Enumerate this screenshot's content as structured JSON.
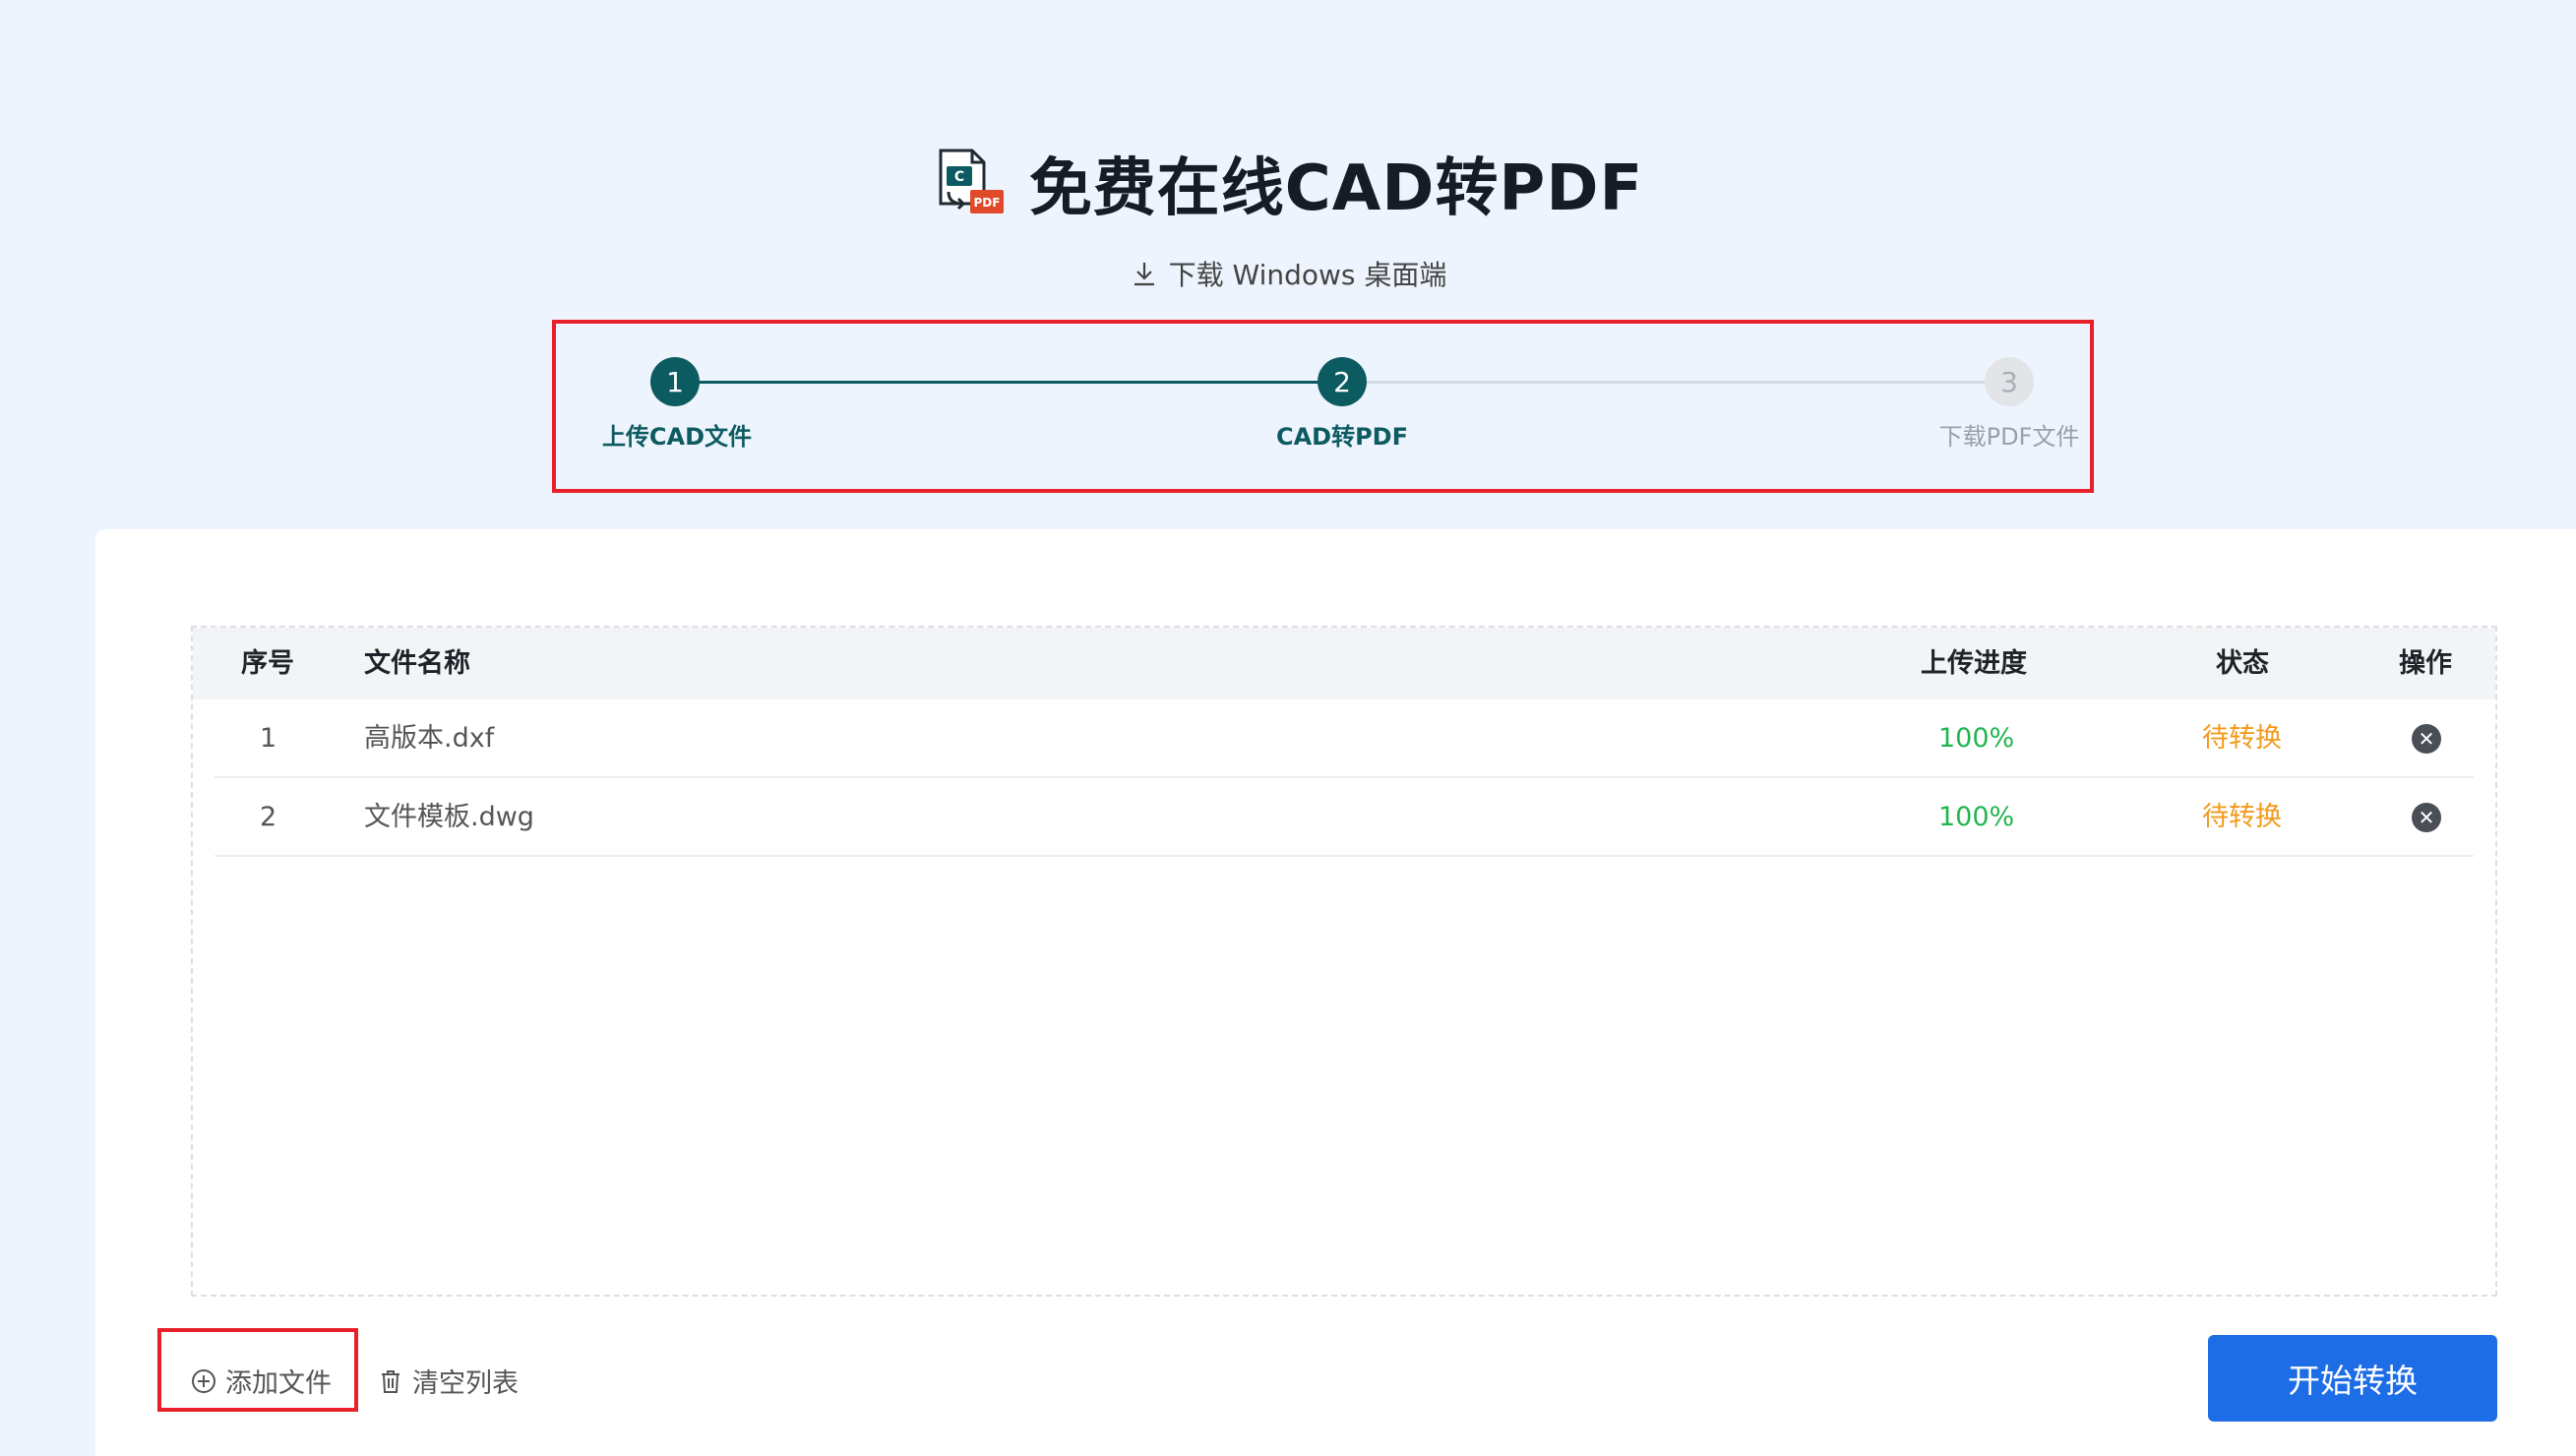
{
  "header": {
    "title": "免费在线CAD转PDF",
    "download_label": "下载 Windows 桌面端",
    "logo_badge_letter": "C",
    "logo_badge_pdf": "PDF"
  },
  "steps": [
    {
      "number": "1",
      "label": "上传CAD文件",
      "state": "done"
    },
    {
      "number": "2",
      "label": "CAD转PDF",
      "state": "active"
    },
    {
      "number": "3",
      "label": "下载PDF文件",
      "state": "pending"
    }
  ],
  "table": {
    "headers": {
      "index": "序号",
      "name": "文件名称",
      "progress": "上传进度",
      "status": "状态",
      "action": "操作"
    },
    "rows": [
      {
        "index": "1",
        "name": "高版本.dxf",
        "progress": "100%",
        "status": "待转换"
      },
      {
        "index": "2",
        "name": "文件模板.dwg",
        "progress": "100%",
        "status": "待转换"
      }
    ]
  },
  "actions": {
    "add_file": "添加文件",
    "clear_list": "清空列表",
    "start": "开始转换"
  },
  "colors": {
    "accent": "#0c5b60",
    "primary_button": "#1d6de6",
    "progress_text": "#21b54e",
    "status_text": "#f39a1d",
    "highlight_border": "#e8202a"
  }
}
